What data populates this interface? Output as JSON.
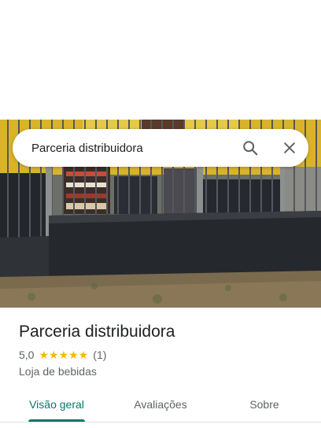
{
  "search": {
    "value": "Parceria distribuidora",
    "search_icon": "search-icon",
    "close_icon": "close-icon"
  },
  "place": {
    "name": "Parceria distribuidora",
    "rating": "5,0",
    "stars": 5,
    "reviews": "(1)",
    "category": "Loja de bebidas"
  },
  "tabs": [
    {
      "label": "Visão geral",
      "active": true
    },
    {
      "label": "Avaliações",
      "active": false
    },
    {
      "label": "Sobre",
      "active": false
    }
  ],
  "colors": {
    "accent": "#00796b",
    "star": "#f5b800",
    "text_primary": "#202124",
    "text_secondary": "#5f6368"
  }
}
